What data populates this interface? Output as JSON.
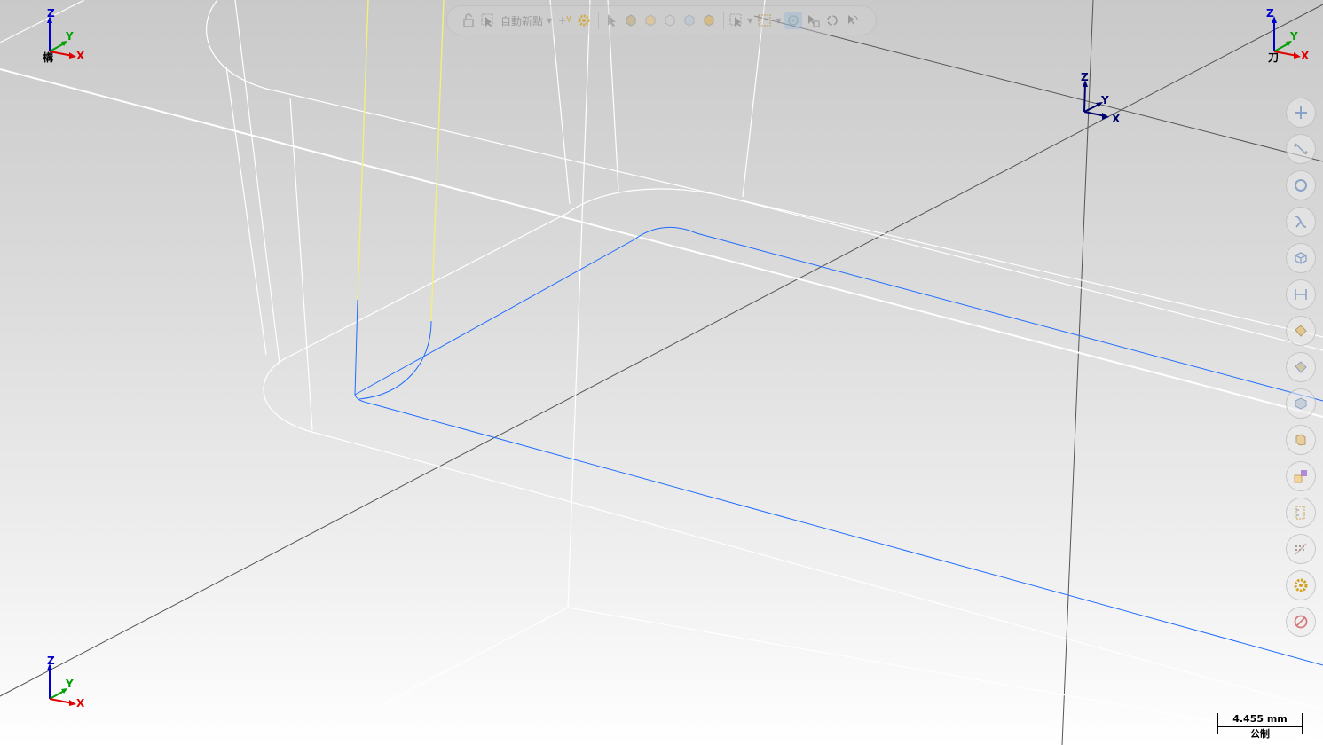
{
  "toolbar": {
    "auto_new_point_label": "自動新點"
  },
  "triads": {
    "top_left": {
      "z": "Z",
      "y": "Y",
      "x": "X",
      "name": "構"
    },
    "top_right": {
      "z": "Z",
      "y": "Y",
      "x": "X",
      "name": "刀"
    },
    "center": {
      "z": "Z",
      "y": "Y",
      "x": "X"
    },
    "bottom_left": {
      "z": "Z",
      "y": "Y",
      "x": "X"
    }
  },
  "scale_bar": {
    "value": "4.455 mm",
    "unit_system": "公制"
  },
  "colors": {
    "toolpath_blue": "#1e6cff",
    "tool_yellow": "#f2f07a",
    "geometry_white": "#ffffff",
    "axis_dark": "#555555",
    "triad_z": "#0000cc",
    "triad_y": "#00a000",
    "triad_x": "#e00000"
  },
  "side_tools": [
    "point-icon",
    "line-icon",
    "circle-icon",
    "spline-icon",
    "surface-icon",
    "dimension-icon",
    "solid-icon",
    "solid-edit-icon",
    "mesh-icon",
    "stock-icon",
    "transform-icon",
    "wireframe-icon",
    "grid-icon",
    "settings-icon",
    "prohibit-icon"
  ]
}
